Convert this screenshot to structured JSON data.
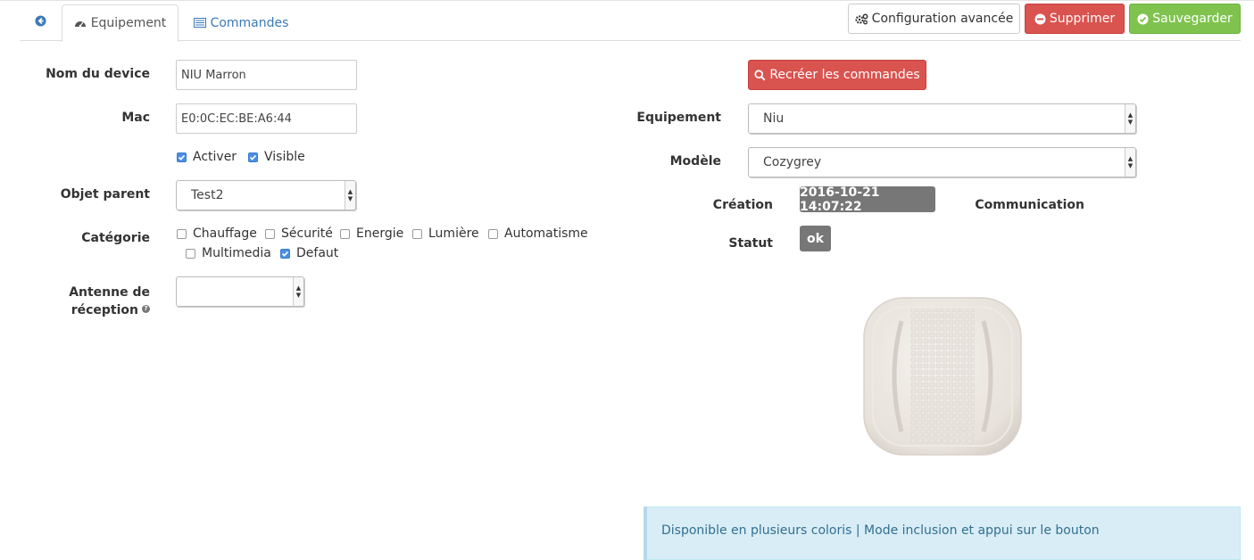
{
  "tabs": {
    "equipement": "Equipement",
    "commandes": "Commandes"
  },
  "toolbar": {
    "config": "Configuration avancée",
    "delete": "Supprimer",
    "save": "Sauvegarder"
  },
  "form_left": {
    "name_label": "Nom du device",
    "name_value": "NIU Marron",
    "mac_label": "Mac",
    "mac_value": "E0:0C:EC:BE:A6:44",
    "activer": "Activer",
    "visible": "Visible",
    "parent_label": "Objet parent",
    "parent_value": "Test2",
    "categorie_label": "Catégorie",
    "categories": [
      {
        "label": "Chauffage",
        "checked": false
      },
      {
        "label": "Sécurité",
        "checked": false
      },
      {
        "label": "Energie",
        "checked": false
      },
      {
        "label": "Lumière",
        "checked": false
      },
      {
        "label": "Automatisme",
        "checked": false
      },
      {
        "label": "Multimedia",
        "checked": false
      },
      {
        "label": "Defaut",
        "checked": true
      }
    ],
    "antenne_label_1": "Antenne de",
    "antenne_label_2": "réception",
    "antenne_value": ""
  },
  "form_right": {
    "recreate": "Recréer les commandes",
    "equipement_label": "Equipement",
    "equipement_value": "Niu",
    "modele_label": "Modèle",
    "modele_value": "Cozygrey",
    "creation_label": "Création",
    "creation_value": "2016-10-21 14:07:22",
    "communication_label": "Communication",
    "statut_label": "Statut",
    "statut_value": "ok"
  },
  "info": {
    "text": "Disponible en plusieurs coloris | Mode inclusion et appui sur le bouton"
  },
  "colors": {
    "primary": "#3c79b6",
    "danger": "#d9534f",
    "success": "#7fc34e",
    "badge": "#777777",
    "info_bg": "#d9edf7"
  }
}
